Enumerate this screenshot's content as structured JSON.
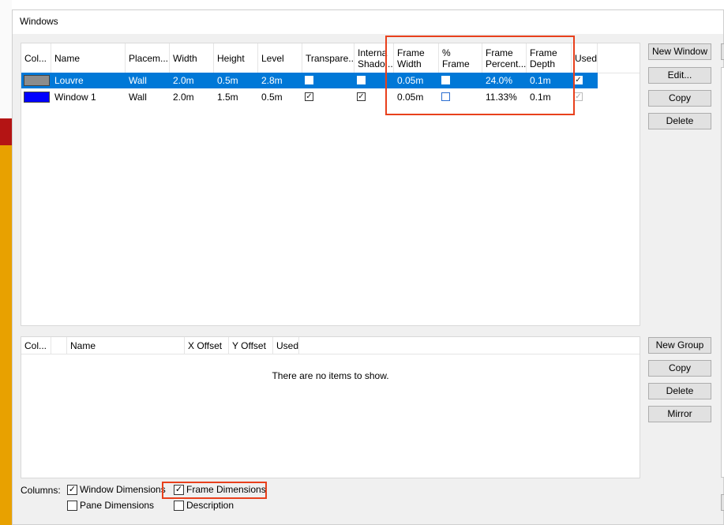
{
  "window": {
    "title": "Windows"
  },
  "windows_table": {
    "headers": [
      "Col...",
      "Name",
      "Placem...",
      "Width",
      "Height",
      "Level",
      "Transpare...",
      "Interna\nShado...",
      "Frame\nWidth",
      "% Frame",
      "Frame\nPercent...",
      "Frame\nDepth",
      "Used"
    ],
    "rows": [
      {
        "color": "#8c8c8c",
        "name": "Louvre",
        "placement": "Wall",
        "width": "2.0m",
        "height": "0.5m",
        "level": "2.8m",
        "transparent": false,
        "internal_shadow": false,
        "frame_width": "0.05m",
        "percent_frame": false,
        "frame_percent": "24.0%",
        "frame_depth": "0.1m",
        "used": true,
        "selected": true
      },
      {
        "color": "#0000ff",
        "name": "Window 1",
        "placement": "Wall",
        "width": "2.0m",
        "height": "1.5m",
        "level": "0.5m",
        "transparent": true,
        "internal_shadow": true,
        "frame_width": "0.05m",
        "percent_frame": false,
        "frame_percent": "11.33%",
        "frame_depth": "0.1m",
        "used": true,
        "selected": false
      }
    ]
  },
  "window_buttons": {
    "new_window": "New Window",
    "edit": "Edit...",
    "copy": "Copy",
    "delete": "Delete"
  },
  "groups_table": {
    "headers": [
      "Col...",
      "",
      "Name",
      "X Offset",
      "Y Offset",
      "Used"
    ],
    "empty_message": "There are no items to show."
  },
  "group_buttons": {
    "new_group": "New Group",
    "copy": "Copy",
    "delete": "Delete",
    "mirror": "Mirror"
  },
  "columns": {
    "label": "Columns:",
    "window_dimensions": {
      "label": "Window Dimensions",
      "checked": true
    },
    "frame_dimensions": {
      "label": "Frame Dimensions",
      "checked": true
    },
    "pane_dimensions": {
      "label": "Pane Dimensions",
      "checked": false
    },
    "description": {
      "label": "Description",
      "checked": false
    }
  },
  "colors": {
    "selection": "#0078d7",
    "highlight": "#e8401c"
  },
  "icons": {
    "check": "checkmark-icon"
  }
}
